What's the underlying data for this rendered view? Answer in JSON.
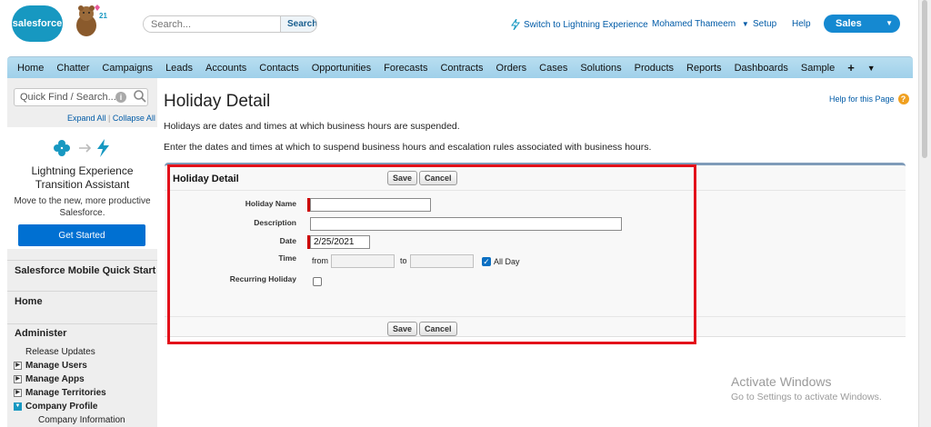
{
  "header": {
    "logo_text": "salesforce",
    "release_badge": "21",
    "search_placeholder": "Search...",
    "search_button": "Search",
    "switch_link": "Switch to Lightning Experience",
    "user_name": "Mohamed Thameem",
    "setup": "Setup",
    "help": "Help",
    "app_name": "Sales"
  },
  "tabs": [
    "Home",
    "Chatter",
    "Campaigns",
    "Leads",
    "Accounts",
    "Contacts",
    "Opportunities",
    "Forecasts",
    "Contracts",
    "Orders",
    "Cases",
    "Solutions",
    "Products",
    "Reports",
    "Dashboards",
    "Sample",
    "+",
    "▼"
  ],
  "sidebar": {
    "quick_find_placeholder": "Quick Find / Search...",
    "expand_all": "Expand All",
    "collapse_all": "Collapse All",
    "lex_title": "Lightning Experience Transition Assistant",
    "lex_subtitle": "Move to the new, more productive Salesforce.",
    "get_started": "Get Started",
    "mobile_quick_start": "Salesforce Mobile Quick Start",
    "home": "Home",
    "administer": "Administer",
    "items": {
      "release_updates": "Release Updates",
      "manage_users": "Manage Users",
      "manage_apps": "Manage Apps",
      "manage_territories": "Manage Territories",
      "company_profile": "Company Profile",
      "company_information": "Company Information"
    }
  },
  "main": {
    "title": "Holiday Detail",
    "help_link": "Help for this Page",
    "intro1": "Holidays are dates and times at which business hours are suspended.",
    "intro2": "Enter the dates and times at which to suspend business hours and escalation rules associated with business hours."
  },
  "form": {
    "section_title": "Holiday Detail",
    "save": "Save",
    "cancel": "Cancel",
    "labels": {
      "holiday_name": "Holiday Name",
      "description": "Description",
      "date": "Date",
      "time": "Time",
      "recurring": "Recurring Holiday"
    },
    "values": {
      "holiday_name": "",
      "description": "",
      "date": "2/25/2021",
      "time_from": "",
      "time_to": ""
    },
    "from_label": "from",
    "to_label": "to",
    "all_day_label": "All Day",
    "all_day_checked": true,
    "recurring_checked": false
  },
  "watermark": {
    "line1": "Activate Windows",
    "line2": "Go to Settings to activate Windows."
  },
  "colors": {
    "brand": "#1798c1",
    "tab_bar": "#a8d4ec",
    "app_button": "#1589d1",
    "get_started": "#0070d2",
    "highlight": "#e3101a",
    "required": "#cc0000"
  }
}
